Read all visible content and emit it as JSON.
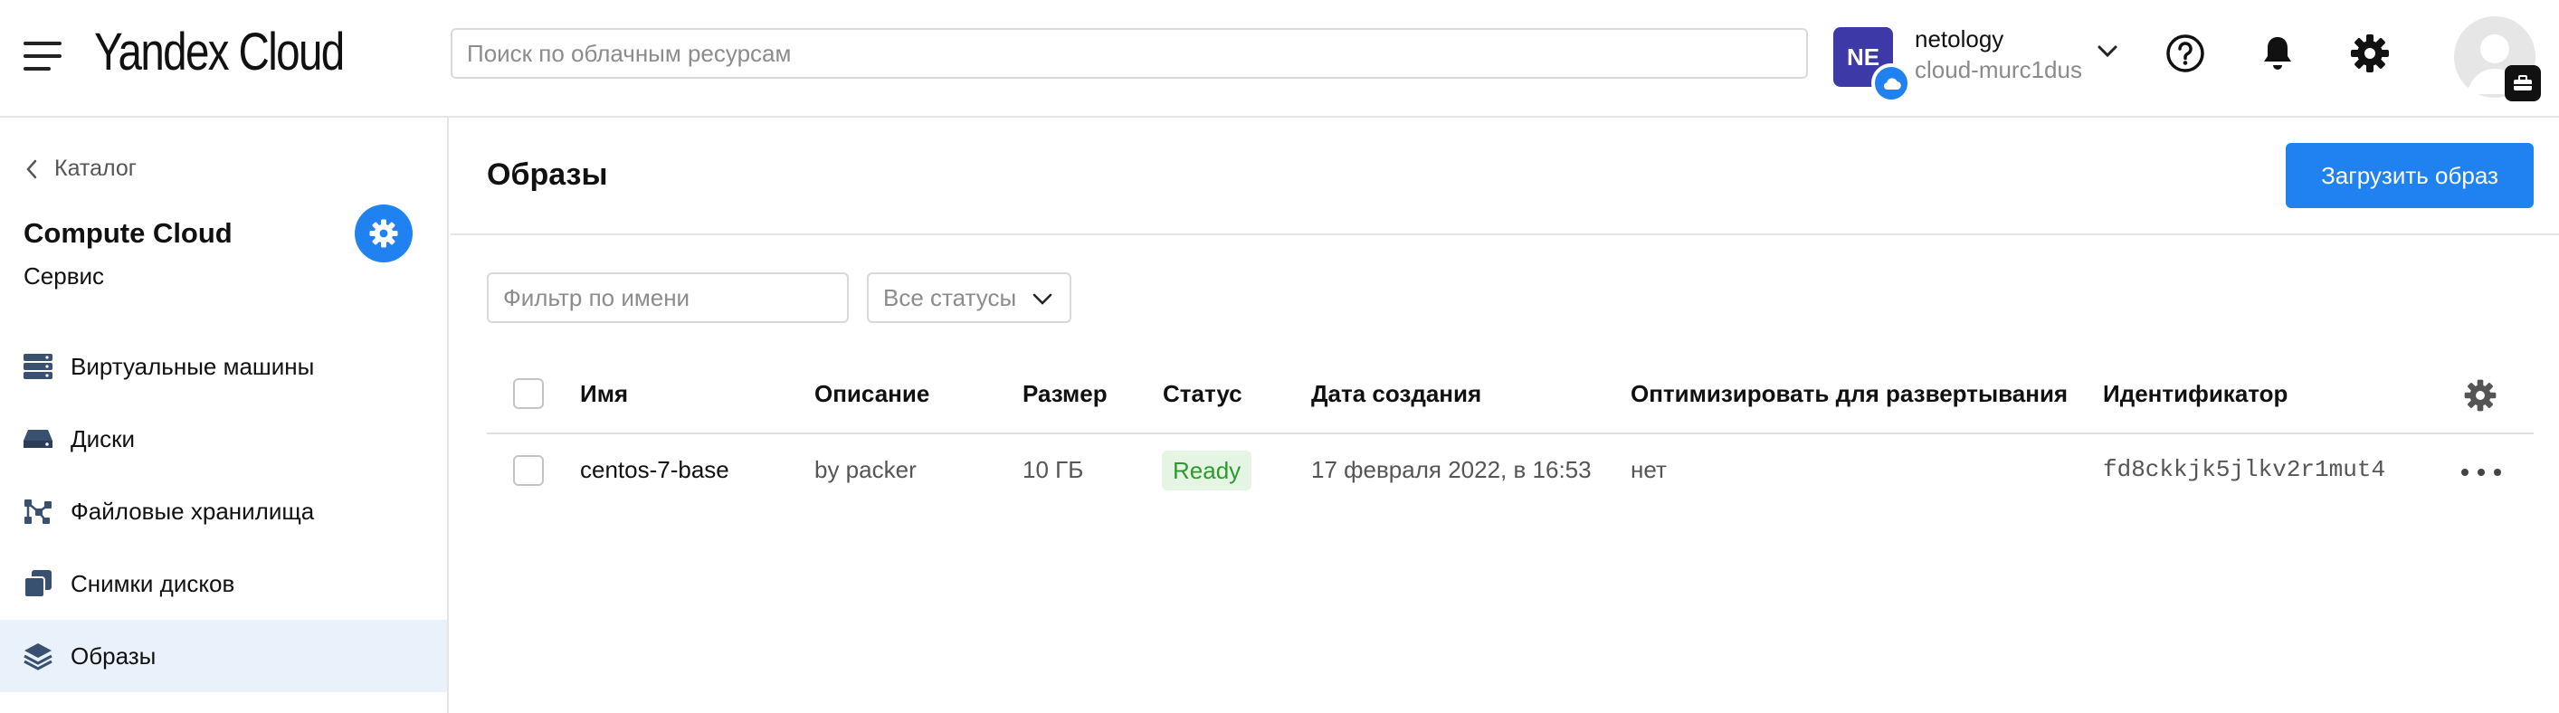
{
  "header": {
    "logo": "Yandex Cloud",
    "search_placeholder": "Поиск по облачным ресурсам",
    "org_initials": "NE",
    "org_name": "netology",
    "cloud_name": "cloud-murc1dus"
  },
  "sidebar": {
    "back_label": "Каталог",
    "service_title": "Compute Cloud",
    "service_subtitle": "Сервис",
    "items": [
      {
        "label": "Виртуальные машины",
        "icon": "servers-icon",
        "active": false
      },
      {
        "label": "Диски",
        "icon": "disk-icon",
        "active": false
      },
      {
        "label": "Файловые хранилища",
        "icon": "file-storage-icon",
        "active": false
      },
      {
        "label": "Снимки дисков",
        "icon": "snapshots-icon",
        "active": false
      },
      {
        "label": "Образы",
        "icon": "layers-icon",
        "active": true
      }
    ]
  },
  "main": {
    "title": "Образы",
    "upload_button": "Загрузить образ",
    "filter_placeholder": "Фильтр по имени",
    "status_filter": "Все статусы",
    "columns": {
      "name": "Имя",
      "description": "Описание",
      "size": "Размер",
      "status": "Статус",
      "created": "Дата создания",
      "optimize": "Оптимизировать для развертывания",
      "id": "Идентификатор"
    },
    "rows": [
      {
        "name": "centos-7-base",
        "description": "by packer",
        "size": "10 ГБ",
        "status": "Ready",
        "created": "17 февраля 2022, в 16:53",
        "optimize": "нет",
        "id": "fd8ckkjk5jlkv2r1mut4"
      }
    ]
  },
  "colors": {
    "accent": "#1f82f0",
    "org_avatar": "#3d3aa8",
    "ready_bg": "#e4f5e4",
    "ready_text": "#2e9a2e",
    "active_nav_bg": "#e9f1fb"
  }
}
